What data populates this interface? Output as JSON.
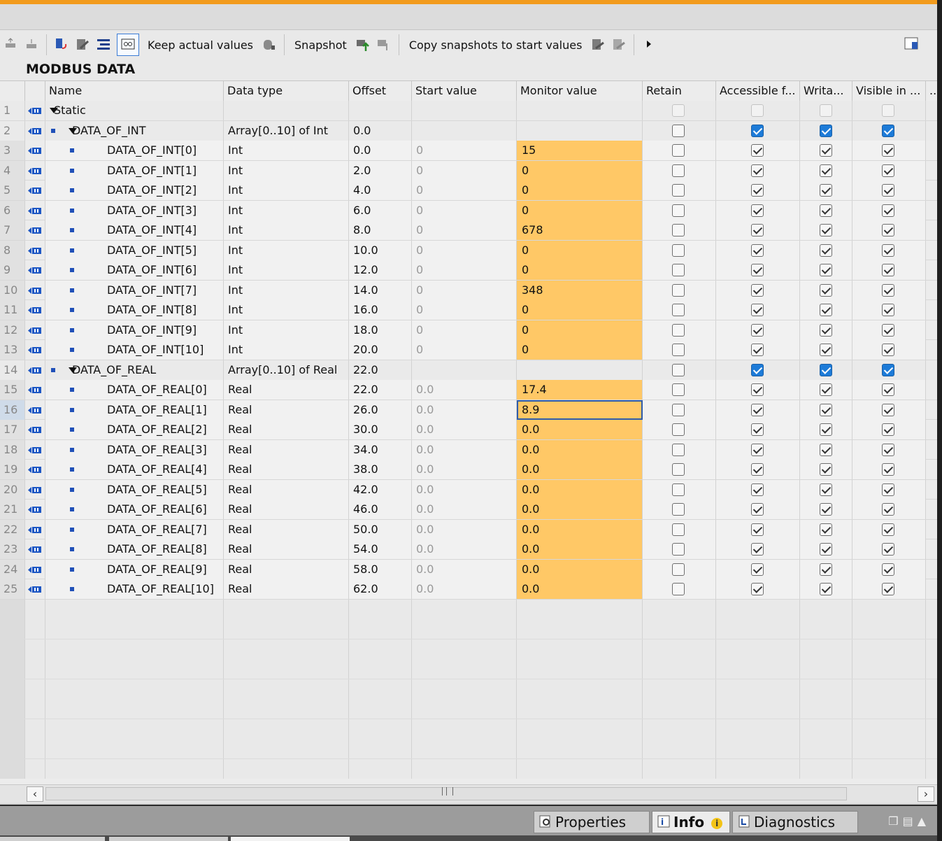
{
  "toolbar": {
    "keep_actual_values": "Keep actual values",
    "snapshot": "Snapshot",
    "copy_snapshots": "Copy snapshots to start values"
  },
  "block_title": "MODBUS DATA",
  "columns": {
    "name": "Name",
    "data_type": "Data type",
    "offset": "Offset",
    "start_value": "Start value",
    "monitor_value": "Monitor value",
    "retain": "Retain",
    "accessible": "Accessible f...",
    "writable": "Writa...",
    "visible": "Visible in ..."
  },
  "rows": [
    {
      "num": "1",
      "name": "Static",
      "type": "",
      "offset": "",
      "start": "",
      "monitor": ""
    },
    {
      "num": "2",
      "name": "DATA_OF_INT",
      "type": "Array[0..10] of Int",
      "offset": "0.0",
      "start": "",
      "monitor": ""
    },
    {
      "num": "3",
      "name": "DATA_OF_INT[0]",
      "type": "Int",
      "offset": "0.0",
      "start": "0",
      "monitor": "15"
    },
    {
      "num": "4",
      "name": "DATA_OF_INT[1]",
      "type": "Int",
      "offset": "2.0",
      "start": "0",
      "monitor": "0"
    },
    {
      "num": "5",
      "name": "DATA_OF_INT[2]",
      "type": "Int",
      "offset": "4.0",
      "start": "0",
      "monitor": "0"
    },
    {
      "num": "6",
      "name": "DATA_OF_INT[3]",
      "type": "Int",
      "offset": "6.0",
      "start": "0",
      "monitor": "0"
    },
    {
      "num": "7",
      "name": "DATA_OF_INT[4]",
      "type": "Int",
      "offset": "8.0",
      "start": "0",
      "monitor": "678"
    },
    {
      "num": "8",
      "name": "DATA_OF_INT[5]",
      "type": "Int",
      "offset": "10.0",
      "start": "0",
      "monitor": "0"
    },
    {
      "num": "9",
      "name": "DATA_OF_INT[6]",
      "type": "Int",
      "offset": "12.0",
      "start": "0",
      "monitor": "0"
    },
    {
      "num": "10",
      "name": "DATA_OF_INT[7]",
      "type": "Int",
      "offset": "14.0",
      "start": "0",
      "monitor": "348"
    },
    {
      "num": "11",
      "name": "DATA_OF_INT[8]",
      "type": "Int",
      "offset": "16.0",
      "start": "0",
      "monitor": "0"
    },
    {
      "num": "12",
      "name": "DATA_OF_INT[9]",
      "type": "Int",
      "offset": "18.0",
      "start": "0",
      "monitor": "0"
    },
    {
      "num": "13",
      "name": "DATA_OF_INT[10]",
      "type": "Int",
      "offset": "20.0",
      "start": "0",
      "monitor": "0"
    },
    {
      "num": "14",
      "name": "DATA_OF_REAL",
      "type": "Array[0..10] of Real",
      "offset": "22.0",
      "start": "",
      "monitor": ""
    },
    {
      "num": "15",
      "name": "DATA_OF_REAL[0]",
      "type": "Real",
      "offset": "22.0",
      "start": "0.0",
      "monitor": "17.4"
    },
    {
      "num": "16",
      "name": "DATA_OF_REAL[1]",
      "type": "Real",
      "offset": "26.0",
      "start": "0.0",
      "monitor": "8.9"
    },
    {
      "num": "17",
      "name": "DATA_OF_REAL[2]",
      "type": "Real",
      "offset": "30.0",
      "start": "0.0",
      "monitor": "0.0"
    },
    {
      "num": "18",
      "name": "DATA_OF_REAL[3]",
      "type": "Real",
      "offset": "34.0",
      "start": "0.0",
      "monitor": "0.0"
    },
    {
      "num": "19",
      "name": "DATA_OF_REAL[4]",
      "type": "Real",
      "offset": "38.0",
      "start": "0.0",
      "monitor": "0.0"
    },
    {
      "num": "20",
      "name": "DATA_OF_REAL[5]",
      "type": "Real",
      "offset": "42.0",
      "start": "0.0",
      "monitor": "0.0"
    },
    {
      "num": "21",
      "name": "DATA_OF_REAL[6]",
      "type": "Real",
      "offset": "46.0",
      "start": "0.0",
      "monitor": "0.0"
    },
    {
      "num": "22",
      "name": "DATA_OF_REAL[7]",
      "type": "Real",
      "offset": "50.0",
      "start": "0.0",
      "monitor": "0.0"
    },
    {
      "num": "23",
      "name": "DATA_OF_REAL[8]",
      "type": "Real",
      "offset": "54.0",
      "start": "0.0",
      "monitor": "0.0"
    },
    {
      "num": "24",
      "name": "DATA_OF_REAL[9]",
      "type": "Real",
      "offset": "58.0",
      "start": "0.0",
      "monitor": "0.0"
    },
    {
      "num": "25",
      "name": "DATA_OF_REAL[10]",
      "type": "Real",
      "offset": "62.0",
      "start": "0.0",
      "monitor": "0.0"
    }
  ],
  "bottom_tabs": {
    "properties": "Properties",
    "info": "Info",
    "info_badge": "i",
    "diagnostics": "Diagnostics"
  },
  "colors": {
    "accent": "#f29b1d",
    "monitor_fill": "#ffc866",
    "checkbox_blue": "#1d7bd8"
  }
}
